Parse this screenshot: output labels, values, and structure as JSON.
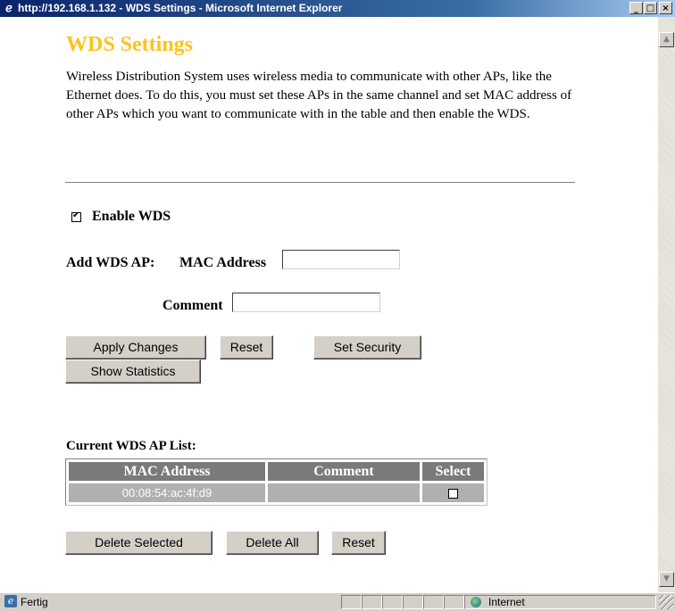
{
  "window": {
    "title": "http://192.168.1.132 - WDS Settings - Microsoft Internet Explorer"
  },
  "page": {
    "title": "WDS Settings",
    "description": "Wireless Distribution System uses wireless media to communicate with other APs, like the Ethernet does. To do this, you must set these APs in the same channel and set MAC address of other APs which you want to communicate with in the table and then enable the WDS."
  },
  "form": {
    "enable_wds": {
      "label": "Enable WDS",
      "checked": true
    },
    "add_wds_ap_label": "Add WDS AP:",
    "mac_address": {
      "label": "MAC Address",
      "value": ""
    },
    "comment": {
      "label": "Comment",
      "value": ""
    },
    "buttons": {
      "apply": "Apply Changes",
      "reset": "Reset",
      "set_security": "Set Security",
      "show_statistics": "Show Statistics"
    }
  },
  "ap_list": {
    "title": "Current WDS AP List:",
    "columns": [
      "MAC Address",
      "Comment",
      "Select"
    ],
    "rows": [
      {
        "mac": "00:08:54:ac:4f:d9",
        "comment": "",
        "selected": false
      }
    ],
    "buttons": {
      "delete_selected": "Delete Selected",
      "delete_all": "Delete All",
      "reset": "Reset"
    }
  },
  "statusbar": {
    "status": "Fertig",
    "zone": "Internet"
  },
  "icons": [
    "ie-icon",
    "minimize-icon",
    "maximize-icon",
    "close-icon",
    "scroll-up-icon",
    "scroll-down-icon",
    "page-done-icon",
    "globe-icon"
  ]
}
